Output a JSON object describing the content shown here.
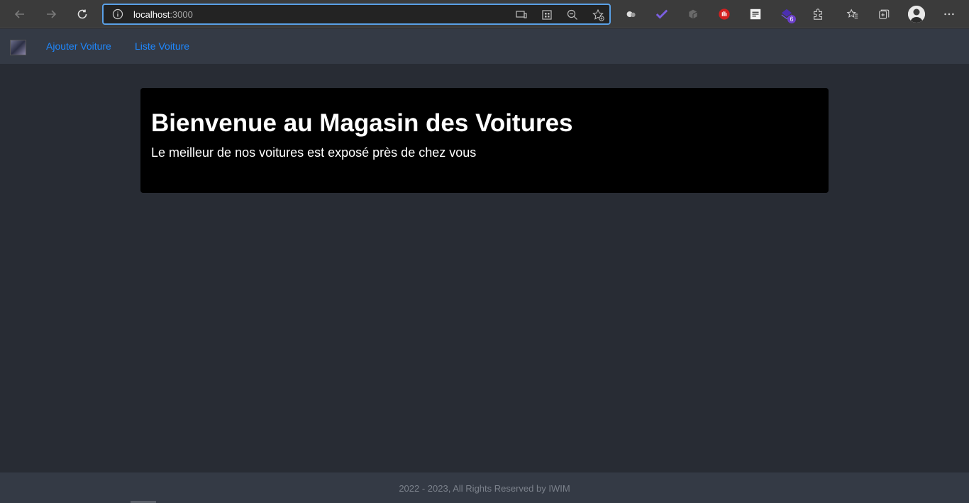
{
  "browser": {
    "url_host": "localhost",
    "url_port": ":3000",
    "extension_badge": "6"
  },
  "app_nav": {
    "links": [
      {
        "label": "Ajouter Voiture"
      },
      {
        "label": "Liste Voiture"
      }
    ]
  },
  "hero": {
    "title": "Bienvenue au Magasin des Voitures",
    "subtitle": "Le meilleur de nos voitures est exposé près de chez vous"
  },
  "footer": {
    "text": "2022 - 2023, All Rights Reserved by IWIM"
  },
  "colors": {
    "page_bg": "#282c34",
    "nav_bg": "#343a45",
    "link": "#1e88ff",
    "hero_bg": "#000000"
  }
}
